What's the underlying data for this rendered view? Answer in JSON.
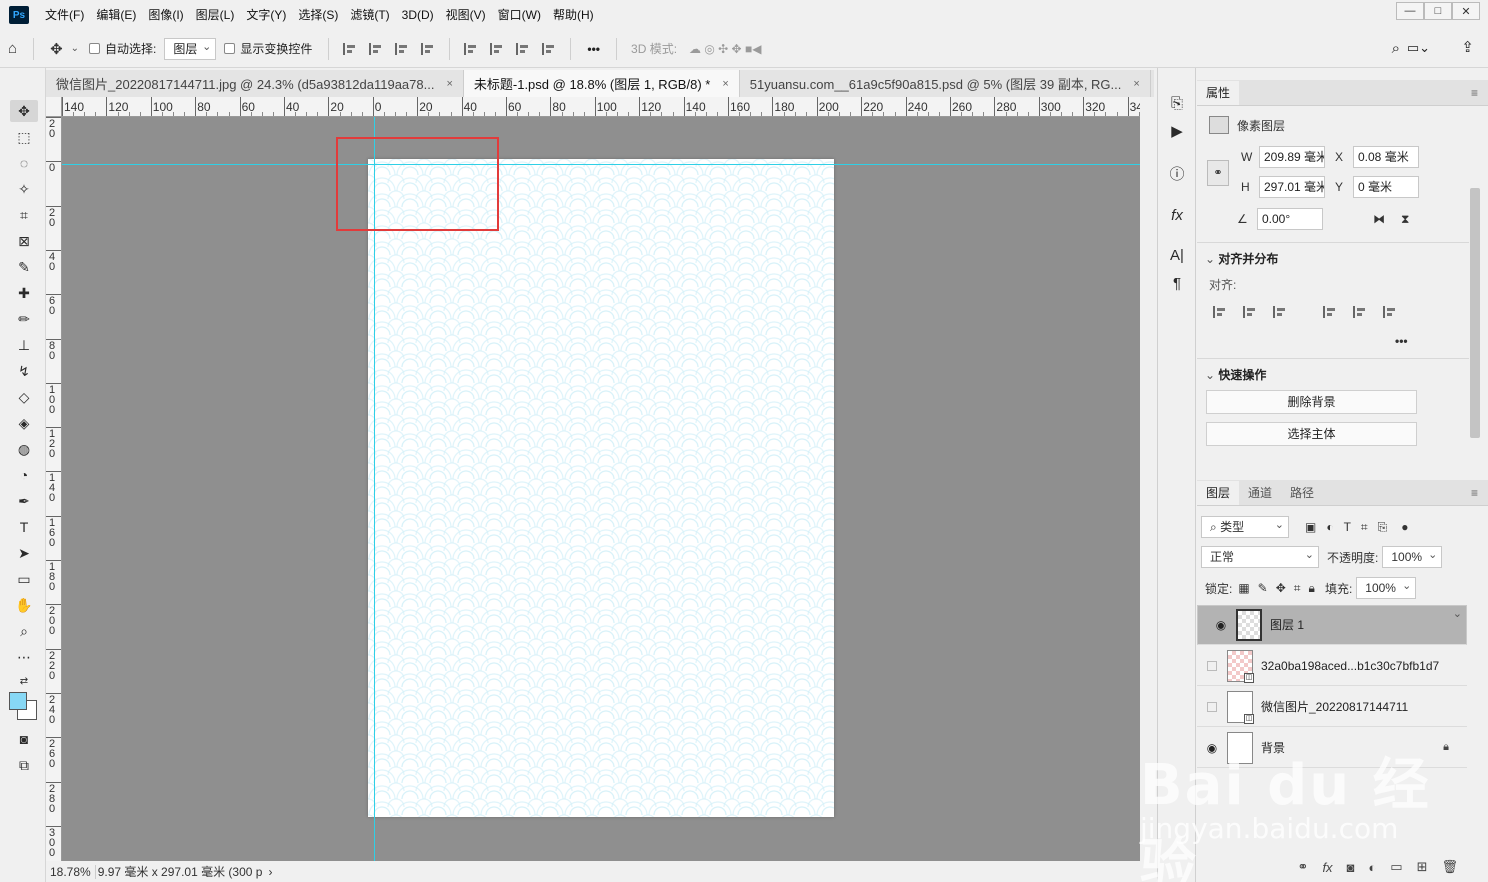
{
  "app": {
    "logo": "Ps"
  },
  "menu": [
    "文件(F)",
    "编辑(E)",
    "图像(I)",
    "图层(L)",
    "文字(Y)",
    "选择(S)",
    "滤镜(T)",
    "3D(D)",
    "视图(V)",
    "窗口(W)",
    "帮助(H)"
  ],
  "window_controls": {
    "minimize": "—",
    "restore": "□",
    "close": "✕"
  },
  "options": {
    "auto_select_label": "自动选择:",
    "auto_select_value": "图层",
    "show_transform_label": "显示变换控件",
    "more": "•••",
    "mode_3d_label": "3D 模式:"
  },
  "tabs": [
    {
      "label": "微信图片_20220817144711.jpg @ 24.3% (d5a93812da119aa78...",
      "close": "×"
    },
    {
      "label": "未标题-1.psd @ 18.8% (图层 1, RGB/8) *",
      "close": "×"
    },
    {
      "label": "51yuansu.com__61a9c5f90a815.psd @ 5% (图层 39 副本, RG...",
      "close": "×"
    }
  ],
  "ruler_top_labels": [
    "140",
    "120",
    "100",
    "80",
    "60",
    "40",
    "20",
    "0",
    "20",
    "40",
    "60",
    "80",
    "100",
    "120",
    "140",
    "160",
    "180",
    "200",
    "220",
    "240",
    "260",
    "280",
    "300",
    "320",
    "34"
  ],
  "ruler_left_labels": [
    "2\n0",
    "0",
    "2\n0",
    "4\n0",
    "6\n0",
    "8\n0",
    "1\n0\n0",
    "1\n2\n0",
    "1\n4\n0",
    "1\n6\n0",
    "1\n8\n0",
    "2\n0\n0",
    "2\n2\n0",
    "2\n4\n0",
    "2\n6\n0",
    "2\n8\n0",
    "3\n0\n0"
  ],
  "status": {
    "zoom": "18.78%",
    "info": "9.97 毫米 x 297.01 毫米 (300 p",
    "arrow": "›"
  },
  "properties": {
    "tab": "属性",
    "type_label": "像素图层",
    "w_label": "W",
    "w_value": "209.89 毫米",
    "x_label": "X",
    "x_value": "0.08 毫米",
    "h_label": "H",
    "h_value": "297.01 毫米",
    "y_label": "Y",
    "y_value": "0 毫米",
    "angle_value": "0.00°",
    "align_section": "对齐并分布",
    "align_label": "对齐:",
    "more": "•••",
    "quick_section": "快速操作",
    "btn_remove_bg": "删除背景",
    "btn_select_subject": "选择主体"
  },
  "layers_panel": {
    "tabs": [
      "图层",
      "通道",
      "路径"
    ],
    "filter_kind": "类型",
    "blend_mode": "正常",
    "opacity_label": "不透明度:",
    "opacity_value": "100%",
    "lock_label": "锁定:",
    "fill_label": "填充:",
    "fill_value": "100%",
    "layers": [
      {
        "name": "图层 1",
        "visible": true
      },
      {
        "name": "32a0ba198aced...b1c30c7bfb1d7",
        "visible": false
      },
      {
        "name": "微信图片_20220817144711",
        "visible": false
      },
      {
        "name": "背景",
        "visible": true
      }
    ]
  },
  "watermark": {
    "line1": "Bai du 经验",
    "line2": "jingyan.baidu.com"
  },
  "colors": {
    "foreground": "#87d8f5",
    "background": "#ffffff",
    "guide": "#2fd0e6",
    "highlight": "#e23b3b"
  }
}
